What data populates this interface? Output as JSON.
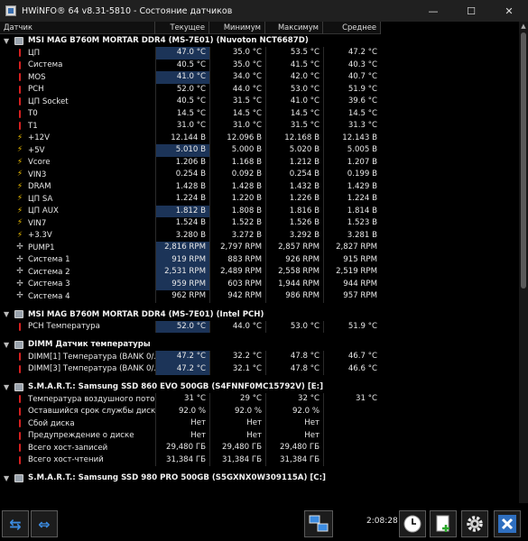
{
  "window": {
    "title": "HWiNFO® 64 v8.31-5810 - Состояние датчиков",
    "minimize": "—",
    "maximize": "☐",
    "close": "✕"
  },
  "columns": {
    "sensor": "Датчик",
    "current": "Текущее",
    "min": "Минимум",
    "max": "Максимум",
    "avg": "Среднее"
  },
  "groups": [
    {
      "title": "MSI MAG B760M MORTAR DDR4 (MS-7E01) (Nuvoton NCT6687D)",
      "rows": [
        {
          "icon": "temp",
          "name": "ЦП",
          "cur": "47.0 °C",
          "min": "35.0 °C",
          "max": "53.5 °C",
          "avg": "47.2 °C",
          "hl": true
        },
        {
          "icon": "temp",
          "name": "Система",
          "cur": "40.5 °C",
          "min": "35.0 °C",
          "max": "41.5 °C",
          "avg": "40.3 °C",
          "hl": false
        },
        {
          "icon": "temp",
          "name": "MOS",
          "cur": "41.0 °C",
          "min": "34.0 °C",
          "max": "42.0 °C",
          "avg": "40.7 °C",
          "hl": true
        },
        {
          "icon": "temp",
          "name": "PCH",
          "cur": "52.0 °C",
          "min": "44.0 °C",
          "max": "53.0 °C",
          "avg": "51.9 °C",
          "hl": false
        },
        {
          "icon": "temp",
          "name": "ЦП Socket",
          "cur": "40.5 °C",
          "min": "31.5 °C",
          "max": "41.0 °C",
          "avg": "39.6 °C",
          "hl": false
        },
        {
          "icon": "temp",
          "name": "T0",
          "cur": "14.5 °C",
          "min": "14.5 °C",
          "max": "14.5 °C",
          "avg": "14.5 °C",
          "hl": false
        },
        {
          "icon": "temp",
          "name": "T1",
          "cur": "31.0 °C",
          "min": "31.0 °C",
          "max": "31.5 °C",
          "avg": "31.3 °C",
          "hl": false
        },
        {
          "icon": "volt",
          "name": "+12V",
          "cur": "12.144 В",
          "min": "12.096 В",
          "max": "12.168 В",
          "avg": "12.143 В",
          "hl": false
        },
        {
          "icon": "volt",
          "name": "+5V",
          "cur": "5.010 В",
          "min": "5.000 В",
          "max": "5.020 В",
          "avg": "5.005 В",
          "hl": true
        },
        {
          "icon": "volt",
          "name": "Vcore",
          "cur": "1.206 В",
          "min": "1.168 В",
          "max": "1.212 В",
          "avg": "1.207 В",
          "hl": false
        },
        {
          "icon": "volt",
          "name": "VIN3",
          "cur": "0.254 В",
          "min": "0.092 В",
          "max": "0.254 В",
          "avg": "0.199 В",
          "hl": false
        },
        {
          "icon": "volt",
          "name": "DRAM",
          "cur": "1.428 В",
          "min": "1.428 В",
          "max": "1.432 В",
          "avg": "1.429 В",
          "hl": false
        },
        {
          "icon": "volt",
          "name": "ЦП SA",
          "cur": "1.224 В",
          "min": "1.220 В",
          "max": "1.226 В",
          "avg": "1.224 В",
          "hl": false
        },
        {
          "icon": "volt",
          "name": "ЦП AUX",
          "cur": "1.812 В",
          "min": "1.808 В",
          "max": "1.816 В",
          "avg": "1.814 В",
          "hl": true
        },
        {
          "icon": "volt",
          "name": "VIN7",
          "cur": "1.524 В",
          "min": "1.522 В",
          "max": "1.526 В",
          "avg": "1.523 В",
          "hl": false
        },
        {
          "icon": "volt",
          "name": "+3.3V",
          "cur": "3.280 В",
          "min": "3.272 В",
          "max": "3.292 В",
          "avg": "3.281 В",
          "hl": false
        },
        {
          "icon": "fan",
          "name": "PUMP1",
          "cur": "2,816 RPM",
          "min": "2,797 RPM",
          "max": "2,857 RPM",
          "avg": "2,827 RPM",
          "hl": true
        },
        {
          "icon": "fan",
          "name": "Система 1",
          "cur": "919 RPM",
          "min": "883 RPM",
          "max": "926 RPM",
          "avg": "915 RPM",
          "hl": true
        },
        {
          "icon": "fan",
          "name": "Система 2",
          "cur": "2,531 RPM",
          "min": "2,489 RPM",
          "max": "2,558 RPM",
          "avg": "2,519 RPM",
          "hl": true
        },
        {
          "icon": "fan",
          "name": "Система 3",
          "cur": "959 RPM",
          "min": "603 RPM",
          "max": "1,944 RPM",
          "avg": "944 RPM",
          "hl": true
        },
        {
          "icon": "fan",
          "name": "Система 4",
          "cur": "962 RPM",
          "min": "942 RPM",
          "max": "986 RPM",
          "avg": "957 RPM",
          "hl": false
        }
      ]
    },
    {
      "title": "MSI MAG B760M MORTAR DDR4 (MS-7E01) (Intel PCH)",
      "rows": [
        {
          "icon": "temp",
          "name": "PCH Температура",
          "cur": "52.0 °C",
          "min": "44.0 °C",
          "max": "53.0 °C",
          "avg": "51.9 °C",
          "hl": true
        }
      ]
    },
    {
      "title": "DIMM Датчик температуры",
      "rows": [
        {
          "icon": "temp",
          "name": "DIMM[1] Температура (BANK 0/...",
          "cur": "47.2 °C",
          "min": "32.2 °C",
          "max": "47.8 °C",
          "avg": "46.7 °C",
          "hl": true
        },
        {
          "icon": "temp",
          "name": "DIMM[3] Температура (BANK 0/...",
          "cur": "47.2 °C",
          "min": "32.1 °C",
          "max": "47.8 °C",
          "avg": "46.6 °C",
          "hl": true
        }
      ]
    },
    {
      "title": "S.M.A.R.T.: Samsung SSD 860 EVO 500GB (S4FNNF0MC15792V) [E:]",
      "rows": [
        {
          "icon": "temp",
          "name": "Температура воздушного пото...",
          "cur": "31 °C",
          "min": "29 °C",
          "max": "32 °C",
          "avg": "31 °C",
          "hl": false
        },
        {
          "icon": "disk",
          "name": "Оставшийся срок службы диска",
          "cur": "92.0 %",
          "min": "92.0 %",
          "max": "92.0 %",
          "avg": "",
          "hl": false
        },
        {
          "icon": "disk",
          "name": "Сбой диска",
          "cur": "Нет",
          "min": "Нет",
          "max": "Нет",
          "avg": "",
          "hl": false
        },
        {
          "icon": "disk",
          "name": "Предупреждение о диске",
          "cur": "Нет",
          "min": "Нет",
          "max": "Нет",
          "avg": "",
          "hl": false
        },
        {
          "icon": "disk",
          "name": "Всего хост-записей",
          "cur": "29,480 ГБ",
          "min": "29,480 ГБ",
          "max": "29,480 ГБ",
          "avg": "",
          "hl": false
        },
        {
          "icon": "disk",
          "name": "Всего хост-чтений",
          "cur": "31,384 ГБ",
          "min": "31,384 ГБ",
          "max": "31,384 ГБ",
          "avg": "",
          "hl": false
        }
      ]
    },
    {
      "title": "S.M.A.R.T.: Samsung SSD 980 PRO 500GB (S5GXNX0W309115A) [C:]",
      "rows": []
    }
  ],
  "statusbar": {
    "time": "2:08:28"
  },
  "colors": {
    "accent": "#3b8be0",
    "highlight": "#1c3458",
    "temp_icon": "#d62020",
    "volt_icon": "#f2c200"
  }
}
